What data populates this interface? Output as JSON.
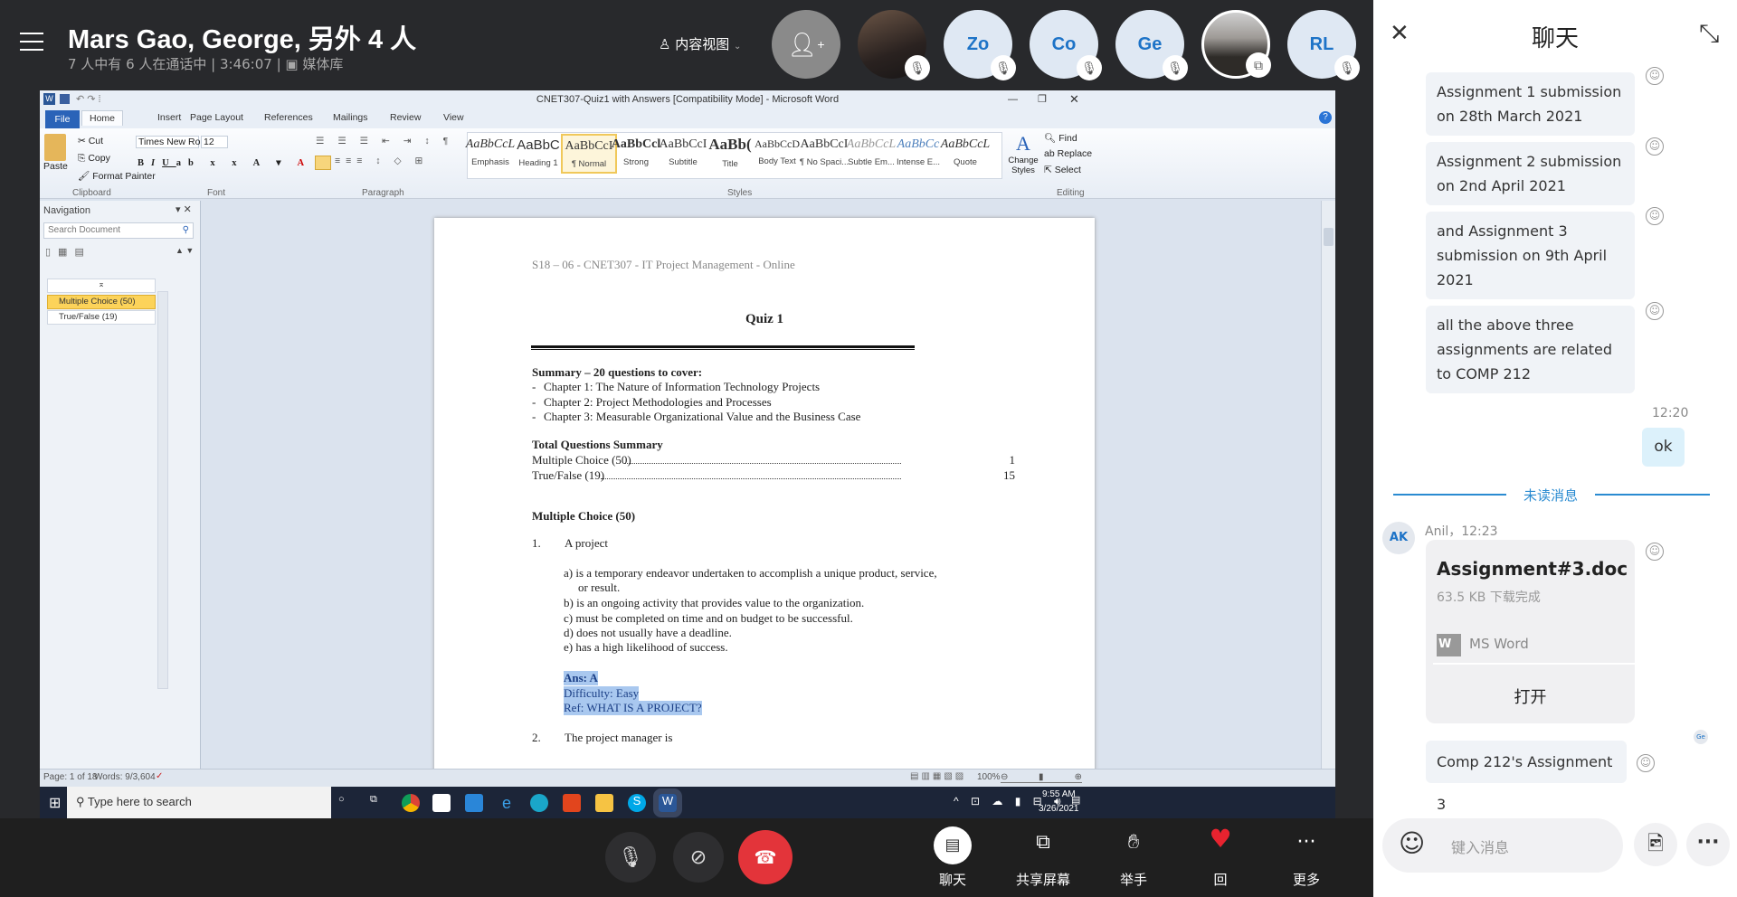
{
  "meeting": {
    "title": "Mars Gao, George, 另外 4 人",
    "subtitle": "7 人中有 6 人在通话中 | 3:46:07 |",
    "media": "媒体库",
    "content_view": "内容视图",
    "participants": [
      {
        "initials": "",
        "type": "photo",
        "muted": true
      },
      {
        "initials": "Zo",
        "muted": true
      },
      {
        "initials": "Co",
        "muted": true
      },
      {
        "initials": "Ge",
        "muted": true
      },
      {
        "initials": "",
        "type": "photo",
        "sharing": true
      },
      {
        "initials": "RL",
        "muted": true
      }
    ]
  },
  "word": {
    "window_title": "CNET307-Quiz1 with Answers [Compatibility Mode] - Microsoft Word",
    "tabs": [
      "File",
      "Home",
      "Insert",
      "Page Layout",
      "References",
      "Mailings",
      "Review",
      "View"
    ],
    "clipboard": {
      "paste": "Paste",
      "cut": "Cut",
      "copy": "Copy",
      "format_painter": "Format Painter",
      "label": "Clipboard"
    },
    "font": {
      "name": "Times New Rom",
      "size": "12",
      "label": "Font"
    },
    "paragraph_label": "Paragraph",
    "styles": [
      {
        "sample": "AaBbCcL",
        "name": "Emphasis"
      },
      {
        "sample": "AaBbC",
        "name": "Heading 1"
      },
      {
        "sample": "AaBbCcI",
        "name": "¶ Normal"
      },
      {
        "sample": "AaBbCcl",
        "name": "Strong"
      },
      {
        "sample": "AaBbCcI",
        "name": "Subtitle"
      },
      {
        "sample": "AaBb(",
        "name": "Title"
      },
      {
        "sample": "AaBbCcD",
        "name": "Body Text"
      },
      {
        "sample": "AaBbCcI",
        "name": "¶ No Spaci..."
      },
      {
        "sample": "AaBbCcL",
        "name": "Subtle Em..."
      },
      {
        "sample": "AaBbCc",
        "name": "Intense E..."
      },
      {
        "sample": "AaBbCcL",
        "name": "Quote"
      }
    ],
    "styles_label": "Styles",
    "change_styles": "Change Styles",
    "editing": {
      "find": "Find",
      "replace": "Replace",
      "select": "Select",
      "label": "Editing"
    },
    "nav": {
      "title": "Navigation",
      "search_placeholder": "Search Document",
      "items": [
        "Multiple Choice (50)",
        "True/False (19)"
      ]
    },
    "doc": {
      "header": "S18 – 06 - CNET307 -  IT Project Management - Online",
      "title": "Quiz 1",
      "summary_heading": "Summary – 20 questions to cover:",
      "chapters": [
        "Chapter 1: The Nature of Information Technology Projects",
        "Chapter 2: Project Methodologies and Processes",
        "Chapter 3: Measurable Organizational Value and the Business Case"
      ],
      "toc_heading": "Total Questions  Summary",
      "toc": [
        {
          "label": "Multiple Choice (50)",
          "page": "1"
        },
        {
          "label": "True/False (19)",
          "page": "15"
        }
      ],
      "section": "Multiple Choice (50)",
      "q1_num": "1.",
      "q1": "A project",
      "options": [
        "a)  is a temporary endeavor undertaken to accomplish  a unique product, service,",
        "or result.",
        "b)  is an ongoing activity that provides value to the organization.",
        "c)  must be completed on time and on budget to be successful.",
        "d)  does not usually have a deadline.",
        "e)  has a high likelihood of success."
      ],
      "ans": "Ans: A",
      "difficulty": "Difficulty:  Easy",
      "ref": "Ref: WHAT IS A PROJECT?",
      "q2_num": "2.",
      "q2": "The project manager is"
    },
    "status": {
      "page": "Page: 1 of 18",
      "words": "Words: 9/3,604",
      "zoom": "100%"
    },
    "taskbar": {
      "search": "Type here to search",
      "time": "9:55 AM",
      "date": "3/26/2021"
    }
  },
  "chat": {
    "title": "聊天",
    "messages": [
      "Assignment 1 submission on 28th March 2021",
      "Assignment 2 submission on 2nd April 2021",
      "and Assignment 3 submission on 9th April 2021",
      "all the above three assignments are related to COMP 212"
    ],
    "own_time": "12:20",
    "own_message": "ok",
    "unread": "未读消息",
    "sender_initials": "AK",
    "sender_meta": "Anil，12:23",
    "file": {
      "name": "Assignment#3.doc",
      "size": "63.5 KB 下载完成",
      "type": "MS Word",
      "open": "打开"
    },
    "reader": "Ge",
    "last_message": "Comp 212's Assignment 3",
    "input_placeholder": "键入消息"
  },
  "controls": [
    {
      "label": "聊天"
    },
    {
      "label": "共享屏幕"
    },
    {
      "label": "举手"
    },
    {
      "label": "回"
    },
    {
      "label": "更多"
    }
  ],
  "colors": {
    "accent": "#2a8bd1",
    "hangup": "#e3343a",
    "heart": "#e8232f",
    "highlight": "#fcd35a"
  }
}
